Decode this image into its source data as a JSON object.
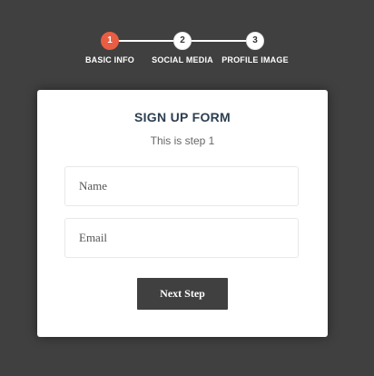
{
  "progress": {
    "steps": [
      {
        "number": "1",
        "label": "BASIC INFO",
        "active": true
      },
      {
        "number": "2",
        "label": "SOCIAL MEDIA",
        "active": false
      },
      {
        "number": "3",
        "label": "PROFILE IMAGE",
        "active": false
      }
    ]
  },
  "form": {
    "title": "SIGN UP FORM",
    "subtitle": "This is step 1",
    "fields": {
      "name": {
        "placeholder": "Name",
        "value": ""
      },
      "email": {
        "placeholder": "Email",
        "value": ""
      }
    },
    "next_button_label": "Next Step"
  },
  "colors": {
    "background": "#404040",
    "active_step": "#e95d43",
    "title": "#2c3e50",
    "button": "#404040"
  },
  "icons": []
}
